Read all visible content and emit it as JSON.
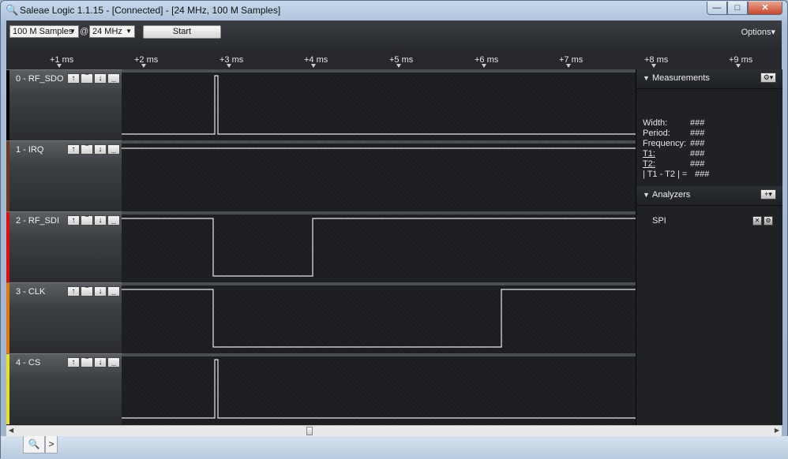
{
  "window": {
    "title": "Saleae Logic 1.1.15 - [Connected] - [24 MHz, 100 M Samples]",
    "buttons": {
      "minimize": "—",
      "maximize": "□",
      "close": "✕"
    }
  },
  "toolbar": {
    "samples_value": "100 M Samples",
    "at_label": "@",
    "rate_value": "24 MHz",
    "start_label": "Start",
    "options_label": "Options▾"
  },
  "ruler": {
    "ticks": [
      "+1 ms",
      "+2 ms",
      "+3 ms",
      "+4 ms",
      "+5 ms",
      "+6 ms",
      "+7 ms",
      "+8 ms",
      "+9 ms"
    ]
  },
  "channels": [
    {
      "name": "0 - RF_SDO",
      "color": "#000000",
      "trig": [
        "↑",
        "‾",
        "↓",
        "_"
      ]
    },
    {
      "name": "1 - IRQ",
      "color": "#6b3a1e",
      "trig": [
        "↑",
        "‾",
        "↓",
        "_"
      ]
    },
    {
      "name": "2 - RF_SDI",
      "color": "#e01010",
      "trig": [
        "↑",
        "‾",
        "↓",
        "_"
      ]
    },
    {
      "name": "3 - CLK",
      "color": "#e07a10",
      "trig": [
        "↑",
        "‾",
        "↓",
        "_"
      ]
    },
    {
      "name": "4 - CS",
      "color": "#e8e020",
      "trig": [
        "↑",
        "‾",
        "↓",
        "_"
      ]
    }
  ],
  "measurements": {
    "title": "Measurements",
    "rows": [
      {
        "label": "Width:",
        "value": "###"
      },
      {
        "label": "Period:",
        "value": "###"
      },
      {
        "label": "Frequency:",
        "value": "###"
      },
      {
        "label": "T1:",
        "value": "###"
      },
      {
        "label": "T2:",
        "value": "###"
      },
      {
        "label": "| T1 - T2 | =",
        "value": "###"
      }
    ]
  },
  "analyzers": {
    "title": "Analyzers",
    "items": [
      {
        "name": "SPI"
      }
    ]
  },
  "bottom": {
    "search_tab": "🔍",
    "more_tab": ">"
  }
}
